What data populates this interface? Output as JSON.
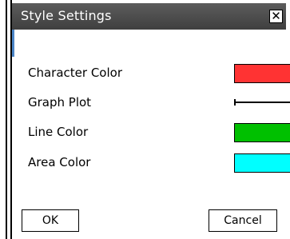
{
  "dialog": {
    "title": "Style Settings",
    "close_glyph": "✕"
  },
  "settings": [
    {
      "label": "Character Color",
      "kind": "color",
      "color": "#ff3333"
    },
    {
      "label": "Graph Plot",
      "kind": "plot"
    },
    {
      "label": "Line Color",
      "kind": "color",
      "color": "#00c000"
    },
    {
      "label": "Area Color",
      "kind": "color",
      "color": "#00ffff"
    }
  ],
  "buttons": {
    "ok_label": "OK",
    "cancel_label": "Cancel"
  }
}
